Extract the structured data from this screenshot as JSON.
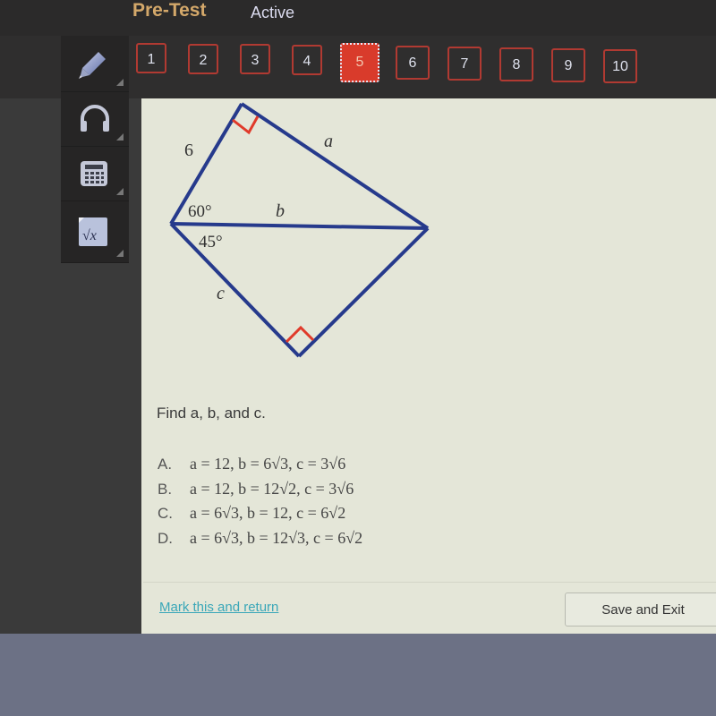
{
  "header": {
    "title": "Pre-Test",
    "status": "Active"
  },
  "question_nav": {
    "items": [
      "1",
      "2",
      "3",
      "4",
      "5",
      "6",
      "7",
      "8",
      "9",
      "10"
    ],
    "active": "5"
  },
  "tools": [
    {
      "name": "pencil",
      "icon": "pencil-icon"
    },
    {
      "name": "audio",
      "icon": "headphones-icon"
    },
    {
      "name": "calculator",
      "icon": "calculator-icon"
    },
    {
      "name": "formula",
      "icon": "square-root-icon"
    }
  ],
  "figure": {
    "labels": {
      "side_top": "6",
      "a": "a",
      "b": "b",
      "c": "c",
      "angle_top": "60°",
      "angle_bottom": "45°"
    },
    "colors": {
      "lines": "#263a8c",
      "right_angle": "#e03a2a"
    }
  },
  "question": {
    "prompt": "Find a, b, and c.",
    "choices": [
      {
        "letter": "A.",
        "text": "a = 12, b = 6√3, c = 3√6"
      },
      {
        "letter": "B.",
        "text": "a = 12, b = 12√2, c = 3√6"
      },
      {
        "letter": "C.",
        "text": "a = 6√3, b = 12, c = 6√2"
      },
      {
        "letter": "D.",
        "text": "a = 6√3, b = 12√3, c = 6√2"
      }
    ]
  },
  "footer": {
    "mark_label": "Mark this and return",
    "save_label": "Save and Exit"
  }
}
